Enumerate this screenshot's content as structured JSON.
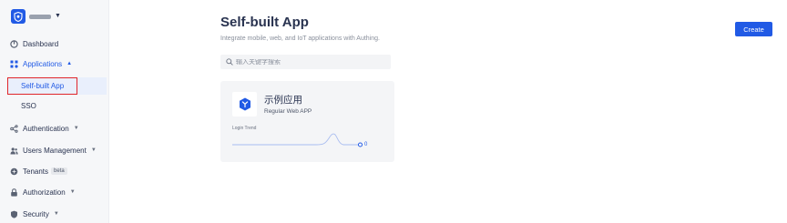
{
  "sidebar": {
    "tenant_logo": "shield-icon",
    "items": [
      {
        "label": "Dashboard",
        "icon": "dashboard-icon"
      },
      {
        "label": "Applications",
        "icon": "applications-icon",
        "expanded": true,
        "active": true
      },
      {
        "label": "Authentication",
        "icon": "authentication-icon"
      },
      {
        "label": "Users Management",
        "icon": "users-icon"
      },
      {
        "label": "Tenants",
        "icon": "tenants-icon",
        "badge": "beta"
      },
      {
        "label": "Authorization",
        "icon": "authorization-icon"
      },
      {
        "label": "Security",
        "icon": "security-icon"
      }
    ],
    "sub_items": [
      {
        "label": "Self-built App",
        "selected": true
      },
      {
        "label": "SSO"
      }
    ]
  },
  "main": {
    "title": "Self-built App",
    "subtitle": "Integrate mobile, web, and IoT applications with Authing.",
    "create_label": "Create",
    "search_placeholder": "输入关键字搜索"
  },
  "app_card": {
    "name": "示例应用",
    "type": "Regular Web APP",
    "trend_label": "Login Trend",
    "trend_value": "0"
  },
  "colors": {
    "accent": "#215ae5",
    "highlight": "#e0262a",
    "sidebar_bg": "#f6f7f9"
  }
}
